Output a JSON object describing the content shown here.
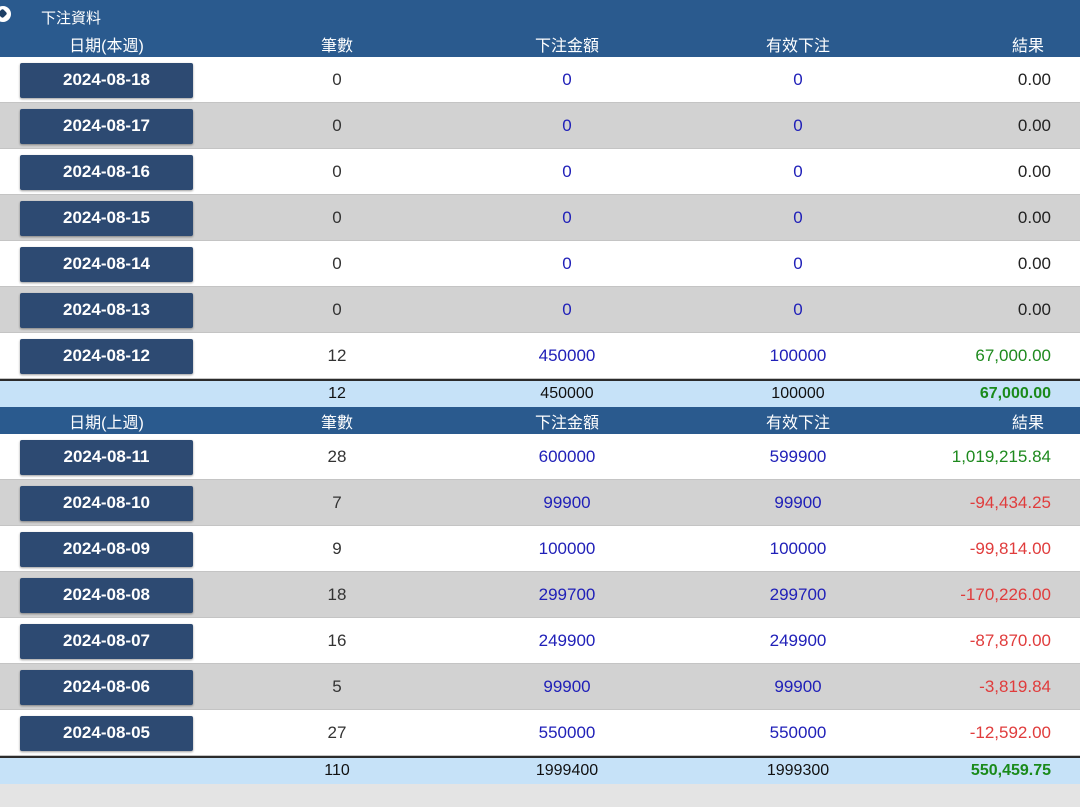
{
  "title": "下注資料",
  "headers_this_week": {
    "date": "日期(本週)",
    "count": "筆數",
    "amount": "下注金額",
    "valid": "有效下注",
    "result": "結果"
  },
  "headers_last_week": {
    "date": "日期(上週)",
    "count": "筆數",
    "amount": "下注金額",
    "valid": "有效下注",
    "result": "結果"
  },
  "this_week": [
    {
      "date": "2024-08-18",
      "count": "0",
      "amount": "0",
      "valid": "0",
      "result": "0.00",
      "sign": "zero"
    },
    {
      "date": "2024-08-17",
      "count": "0",
      "amount": "0",
      "valid": "0",
      "result": "0.00",
      "sign": "zero"
    },
    {
      "date": "2024-08-16",
      "count": "0",
      "amount": "0",
      "valid": "0",
      "result": "0.00",
      "sign": "zero"
    },
    {
      "date": "2024-08-15",
      "count": "0",
      "amount": "0",
      "valid": "0",
      "result": "0.00",
      "sign": "zero"
    },
    {
      "date": "2024-08-14",
      "count": "0",
      "amount": "0",
      "valid": "0",
      "result": "0.00",
      "sign": "zero"
    },
    {
      "date": "2024-08-13",
      "count": "0",
      "amount": "0",
      "valid": "0",
      "result": "0.00",
      "sign": "zero"
    },
    {
      "date": "2024-08-12",
      "count": "12",
      "amount": "450000",
      "valid": "100000",
      "result": "67,000.00",
      "sign": "pos"
    }
  ],
  "this_week_total": {
    "count": "12",
    "amount": "450000",
    "valid": "100000",
    "result": "67,000.00"
  },
  "last_week": [
    {
      "date": "2024-08-11",
      "count": "28",
      "amount": "600000",
      "valid": "599900",
      "result": "1,019,215.84",
      "sign": "pos"
    },
    {
      "date": "2024-08-10",
      "count": "7",
      "amount": "99900",
      "valid": "99900",
      "result": "-94,434.25",
      "sign": "neg"
    },
    {
      "date": "2024-08-09",
      "count": "9",
      "amount": "100000",
      "valid": "100000",
      "result": "-99,814.00",
      "sign": "neg"
    },
    {
      "date": "2024-08-08",
      "count": "18",
      "amount": "299700",
      "valid": "299700",
      "result": "-170,226.00",
      "sign": "neg"
    },
    {
      "date": "2024-08-07",
      "count": "16",
      "amount": "249900",
      "valid": "249900",
      "result": "-87,870.00",
      "sign": "neg"
    },
    {
      "date": "2024-08-06",
      "count": "5",
      "amount": "99900",
      "valid": "99900",
      "result": "-3,819.84",
      "sign": "neg"
    },
    {
      "date": "2024-08-05",
      "count": "27",
      "amount": "550000",
      "valid": "550000",
      "result": "-12,592.00",
      "sign": "neg"
    }
  ],
  "last_week_total": {
    "count": "110",
    "amount": "1999400",
    "valid": "1999300",
    "result": "550,459.75"
  },
  "colors": {
    "header": "#2a5a8e",
    "date_button": "#2d4a72",
    "total_bg": "#c6e2f8",
    "positive": "#1e8a1e",
    "negative": "#e03c3c",
    "amount_blue": "#2020b8"
  }
}
